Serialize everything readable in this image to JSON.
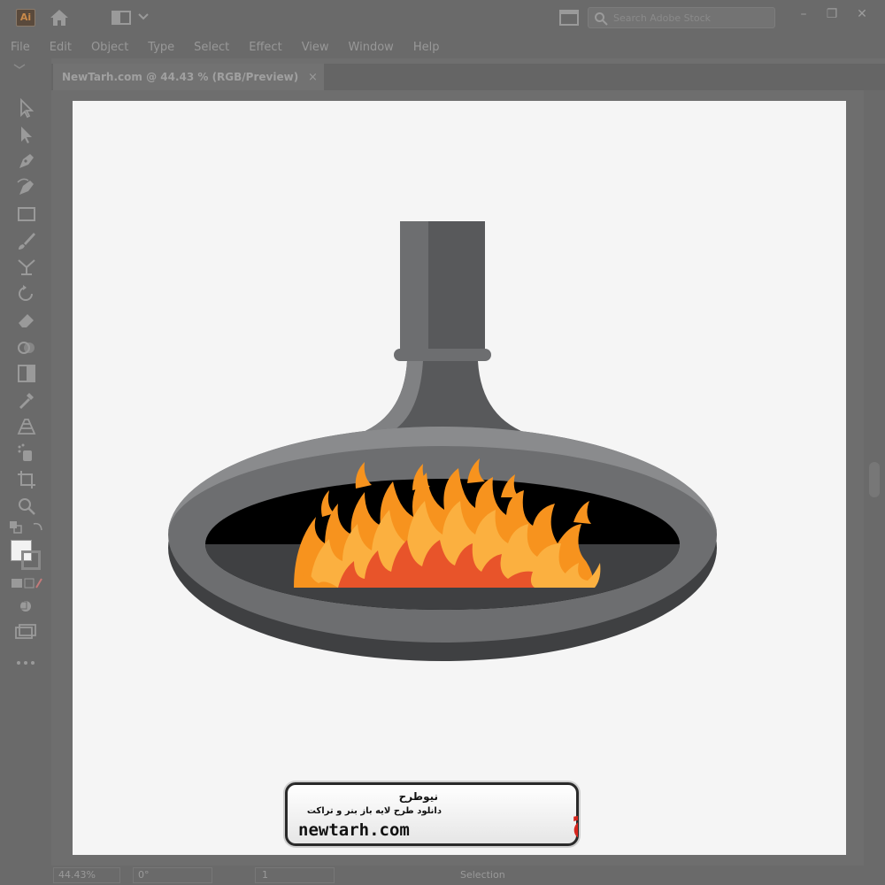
{
  "app": {
    "logo_text": "Ai",
    "workspace_icon": "workspace-switcher-icon"
  },
  "search": {
    "placeholder": "Search Adobe Stock"
  },
  "window_controls": {
    "minimize": "–",
    "restore": "❐",
    "close": "✕"
  },
  "menu": [
    "File",
    "Edit",
    "Object",
    "Type",
    "Select",
    "Effect",
    "View",
    "Window",
    "Help"
  ],
  "document_tab": {
    "title": "NewTarh.com @ 44.43 % (RGB/Preview)",
    "close": "×"
  },
  "tools": [
    "selection-tool-icon",
    "direct-selection-tool-icon",
    "pen-tool-icon",
    "curvature-tool-icon",
    "rectangle-tool-icon",
    "paintbrush-tool-icon",
    "width-tool-icon",
    "rotate-tool-icon",
    "eraser-tool-icon",
    "shape-builder-tool-icon",
    "gradient-tool-icon",
    "eyedropper-tool-icon",
    "perspective-grid-tool-icon",
    "symbol-sprayer-tool-icon",
    "artboard-tool-icon",
    "zoom-tool-icon"
  ],
  "colors": {
    "flame_outer": "#f7931e",
    "flame_light": "#fbb040",
    "flame_inner": "#e8542a",
    "metal_light": "#8a8b8d",
    "metal_mid": "#6d6e70",
    "metal_dark": "#58595b",
    "metal_darkest": "#3f4042",
    "opening": "#000000",
    "artboard": "#f5f5f5"
  },
  "watermark": {
    "title_fa": "نیوطرح",
    "subtitle_fa": "دانلود طرح لایه باز بنر و تراکت",
    "url": "newtarh.com",
    "logo_fa": "نیوطرح"
  },
  "status": {
    "zoom": "44.43%",
    "rotation": "0°",
    "page": "1",
    "tool": "Selection"
  }
}
